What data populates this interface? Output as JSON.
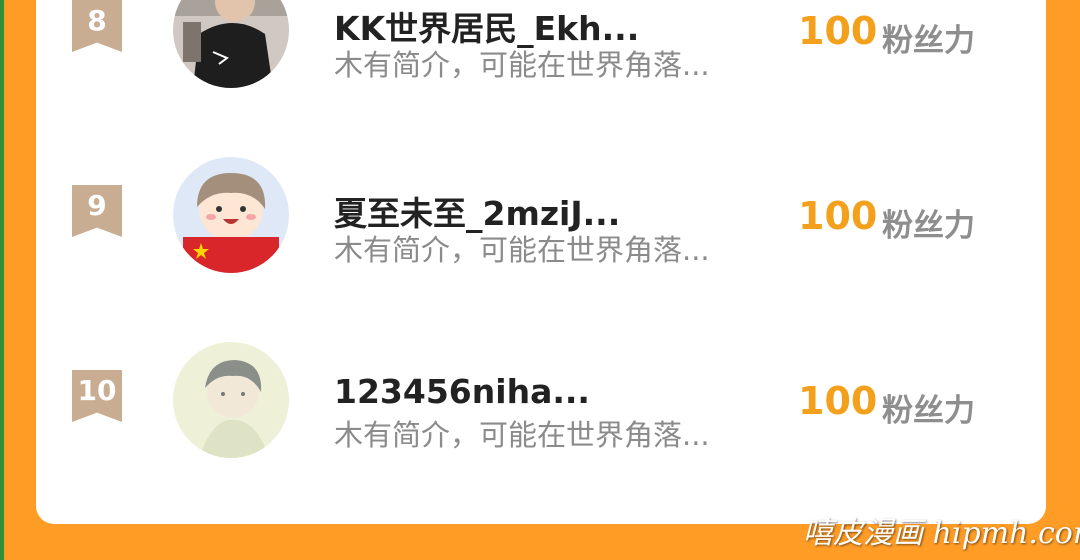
{
  "ranking": [
    {
      "rank": "8",
      "name": "KK世界居民_Ekh...",
      "description": "木有简介，可能在世界角落...",
      "score": "100",
      "score_unit": "粉丝力",
      "avatar": "avatar-dark-clothing"
    },
    {
      "rank": "9",
      "name": "夏至未至_2mziJ...",
      "description": "木有简介，可能在世界角落...",
      "score": "100",
      "score_unit": "粉丝力",
      "avatar": "avatar-cartoon-boy-flag"
    },
    {
      "rank": "10",
      "name": "123456niha...",
      "description": "木有简介，可能在世界角落...",
      "score": "100",
      "score_unit": "粉丝力",
      "avatar": "avatar-anime-soft"
    }
  ],
  "colors": {
    "background": "#ff9c26",
    "rank_badge": "#c9ad92",
    "score": "#f3a11c"
  },
  "watermark": "嘻皮漫画 hipmh.com"
}
